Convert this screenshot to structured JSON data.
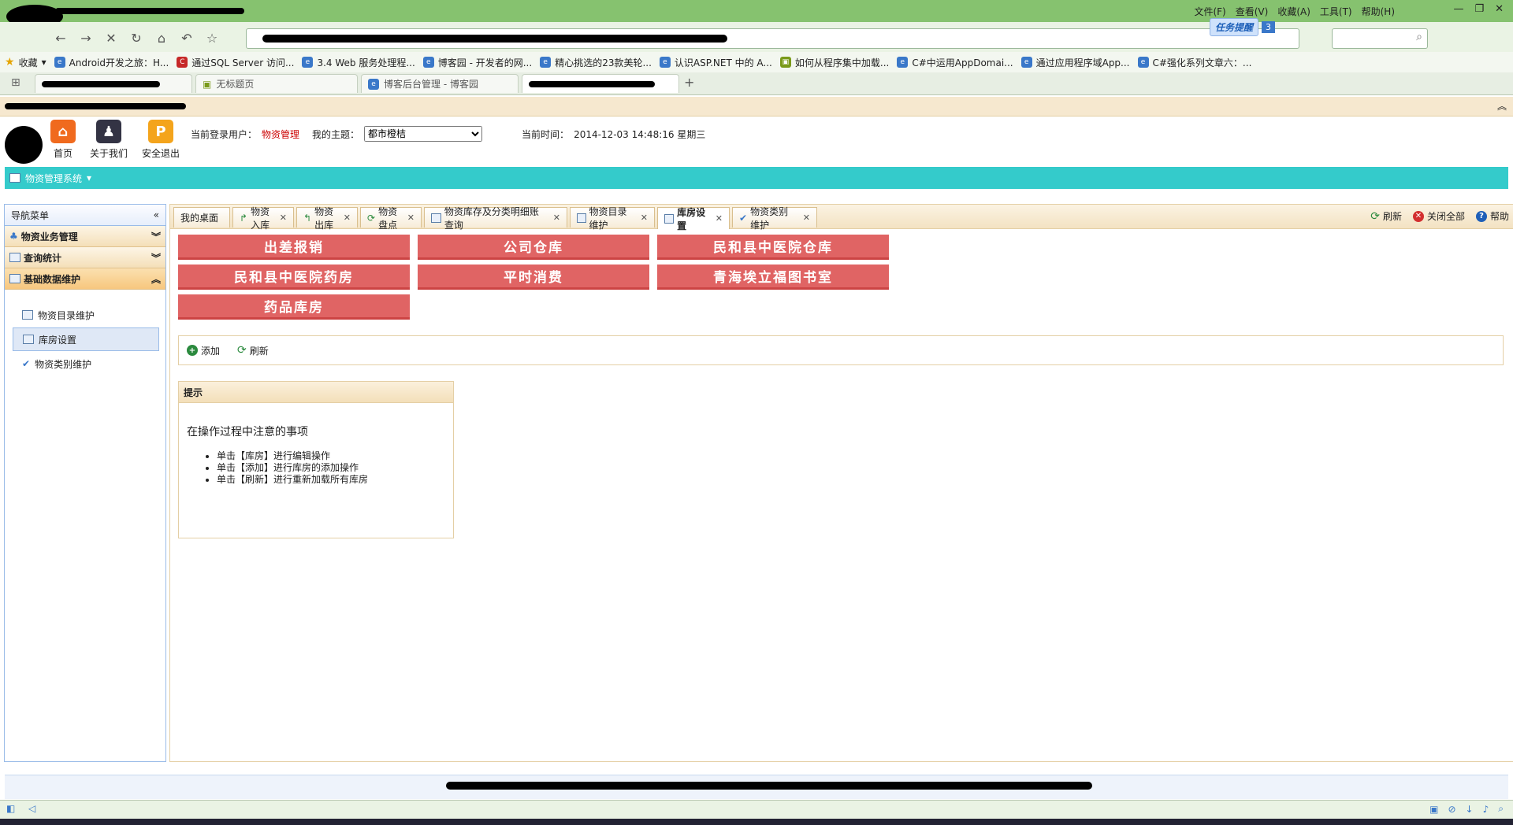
{
  "browser": {
    "menu": [
      "文件(F)",
      "查看(V)",
      "收藏(A)",
      "工具(T)",
      "帮助(H)"
    ],
    "task_badge": "任务提醒",
    "task_count": "3",
    "bookmarks": [
      {
        "icon": "star-icon",
        "label": "收藏"
      },
      {
        "icon": "ie-icon",
        "label": "Android开发之旅：H..."
      },
      {
        "icon": "csdn-icon",
        "label": "通过SQL Server 访问..."
      },
      {
        "icon": "ie-icon",
        "label": "3.4 Web 服务处理程..."
      },
      {
        "icon": "ie-icon",
        "label": "博客园 - 开发者的网..."
      },
      {
        "icon": "ie-icon",
        "label": "精心挑选的23款美轮..."
      },
      {
        "icon": "ie-icon",
        "label": "认识ASP.NET 中的 A..."
      },
      {
        "icon": "bookmark-icon",
        "label": "如何从程序集中加载..."
      },
      {
        "icon": "ie-icon",
        "label": "C#中运用AppDomai..."
      },
      {
        "icon": "ie-icon",
        "label": "通过应用程序域App..."
      },
      {
        "icon": "ie-icon",
        "label": "C#强化系列文章六：..."
      }
    ],
    "tabs": [
      "无标题页",
      "博客后台管理 - 博客园"
    ]
  },
  "header": {
    "home_buttons": [
      {
        "label": "首页",
        "color": "#f06a1e",
        "glyph": "⌂"
      },
      {
        "label": "关于我们",
        "color": "#335",
        "glyph": "♟"
      },
      {
        "label": "安全退出",
        "color": "#f4a41c",
        "glyph": "P"
      }
    ],
    "user_label": "当前登录用户：",
    "user_name": "物资管理",
    "theme_label": "我的主题：",
    "theme_value": "都市橙桔",
    "time_label": "当前时间：",
    "time_value": "2014-12-03 14:48:16 星期三",
    "system_menu": "物资管理系统"
  },
  "sidebar": {
    "title": "导航菜单",
    "sections": [
      {
        "label": "物资业务管理",
        "open": false
      },
      {
        "label": "查询统计",
        "open": false
      },
      {
        "label": "基础数据维护",
        "open": true
      }
    ],
    "items": [
      "物资目录维护",
      "库房设置",
      "物资类别维护"
    ]
  },
  "tabs": [
    "我的桌面",
    "物资入库",
    "物资出库",
    "物资盘点",
    "物资库存及分类明细账查询",
    "物资目录维护",
    "库房设置",
    "物资类别维护"
  ],
  "tools": [
    "刷新",
    "关闭全部",
    "帮助"
  ],
  "warehouses": [
    "出差报销",
    "公司仓库",
    "民和县中医院仓库",
    "民和县中医院药房",
    "平时消费",
    "青海埃立福图书室",
    "药品库房"
  ],
  "toolbar": {
    "add": "添加",
    "refresh": "刷新"
  },
  "tip": {
    "header": "提示",
    "title": "在操作过程中注意的事项",
    "items": [
      "单击【库房】进行编辑操作",
      "单击【添加】进行库房的添加操作",
      "单击【刷新】进行重新加载所有库房"
    ]
  }
}
